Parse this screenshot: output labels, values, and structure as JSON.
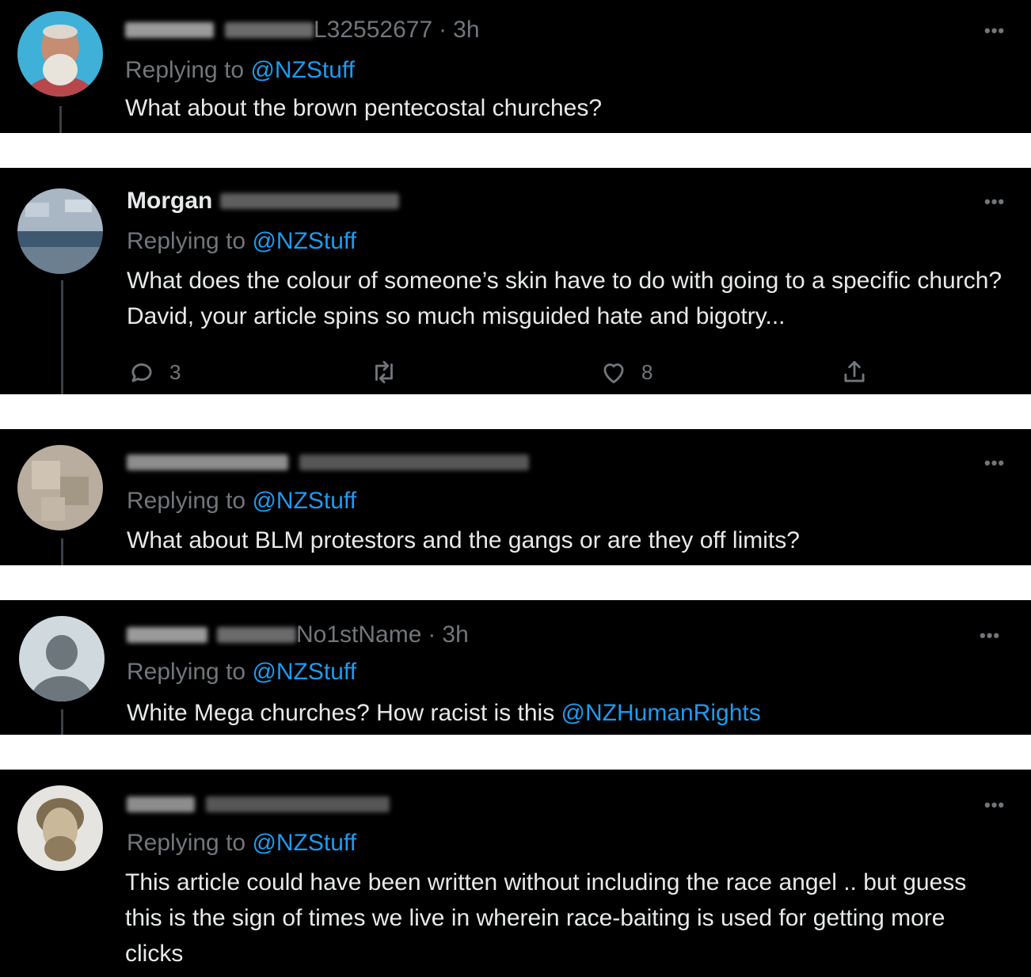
{
  "tweets": [
    {
      "handle_suffix": "L32552677",
      "separator": "·",
      "time": "3h",
      "replying_prefix": "Replying to ",
      "replying_to": "@NZStuff",
      "text": "What about the brown pentecostal churches?"
    },
    {
      "name": "Morgan",
      "replying_prefix": "Replying to ",
      "replying_to": "@NZStuff",
      "text": "What does the colour of someone’s skin have to do with going to a specific church? David, your article spins so much misguided hate and bigotry...",
      "actions": {
        "replies": "3",
        "likes": "8"
      }
    },
    {
      "replying_prefix": "Replying to ",
      "replying_to": "@NZStuff",
      "text": "What about BLM protestors and the gangs or are they off limits?"
    },
    {
      "handle_suffix": "No1stName",
      "separator": "·",
      "time": "3h",
      "replying_prefix": "Replying to ",
      "replying_to": "@NZStuff",
      "text_before": "White Mega churches? How racist is this ",
      "text_mention": "@NZHumanRights"
    },
    {
      "replying_prefix": "Replying to ",
      "replying_to": "@NZStuff",
      "text": "This article could have been written without including the race angel .. but guess this is the sign of times we live in wherein race-baiting is used for getting more clicks"
    }
  ],
  "more_label": "•••",
  "icons": [
    "reply-icon",
    "retweet-icon",
    "like-icon",
    "share-icon",
    "more-icon"
  ],
  "colors": {
    "background": "#000000",
    "text": "#e7e9ea",
    "muted": "#71767b",
    "accent": "#1d9bf0"
  }
}
